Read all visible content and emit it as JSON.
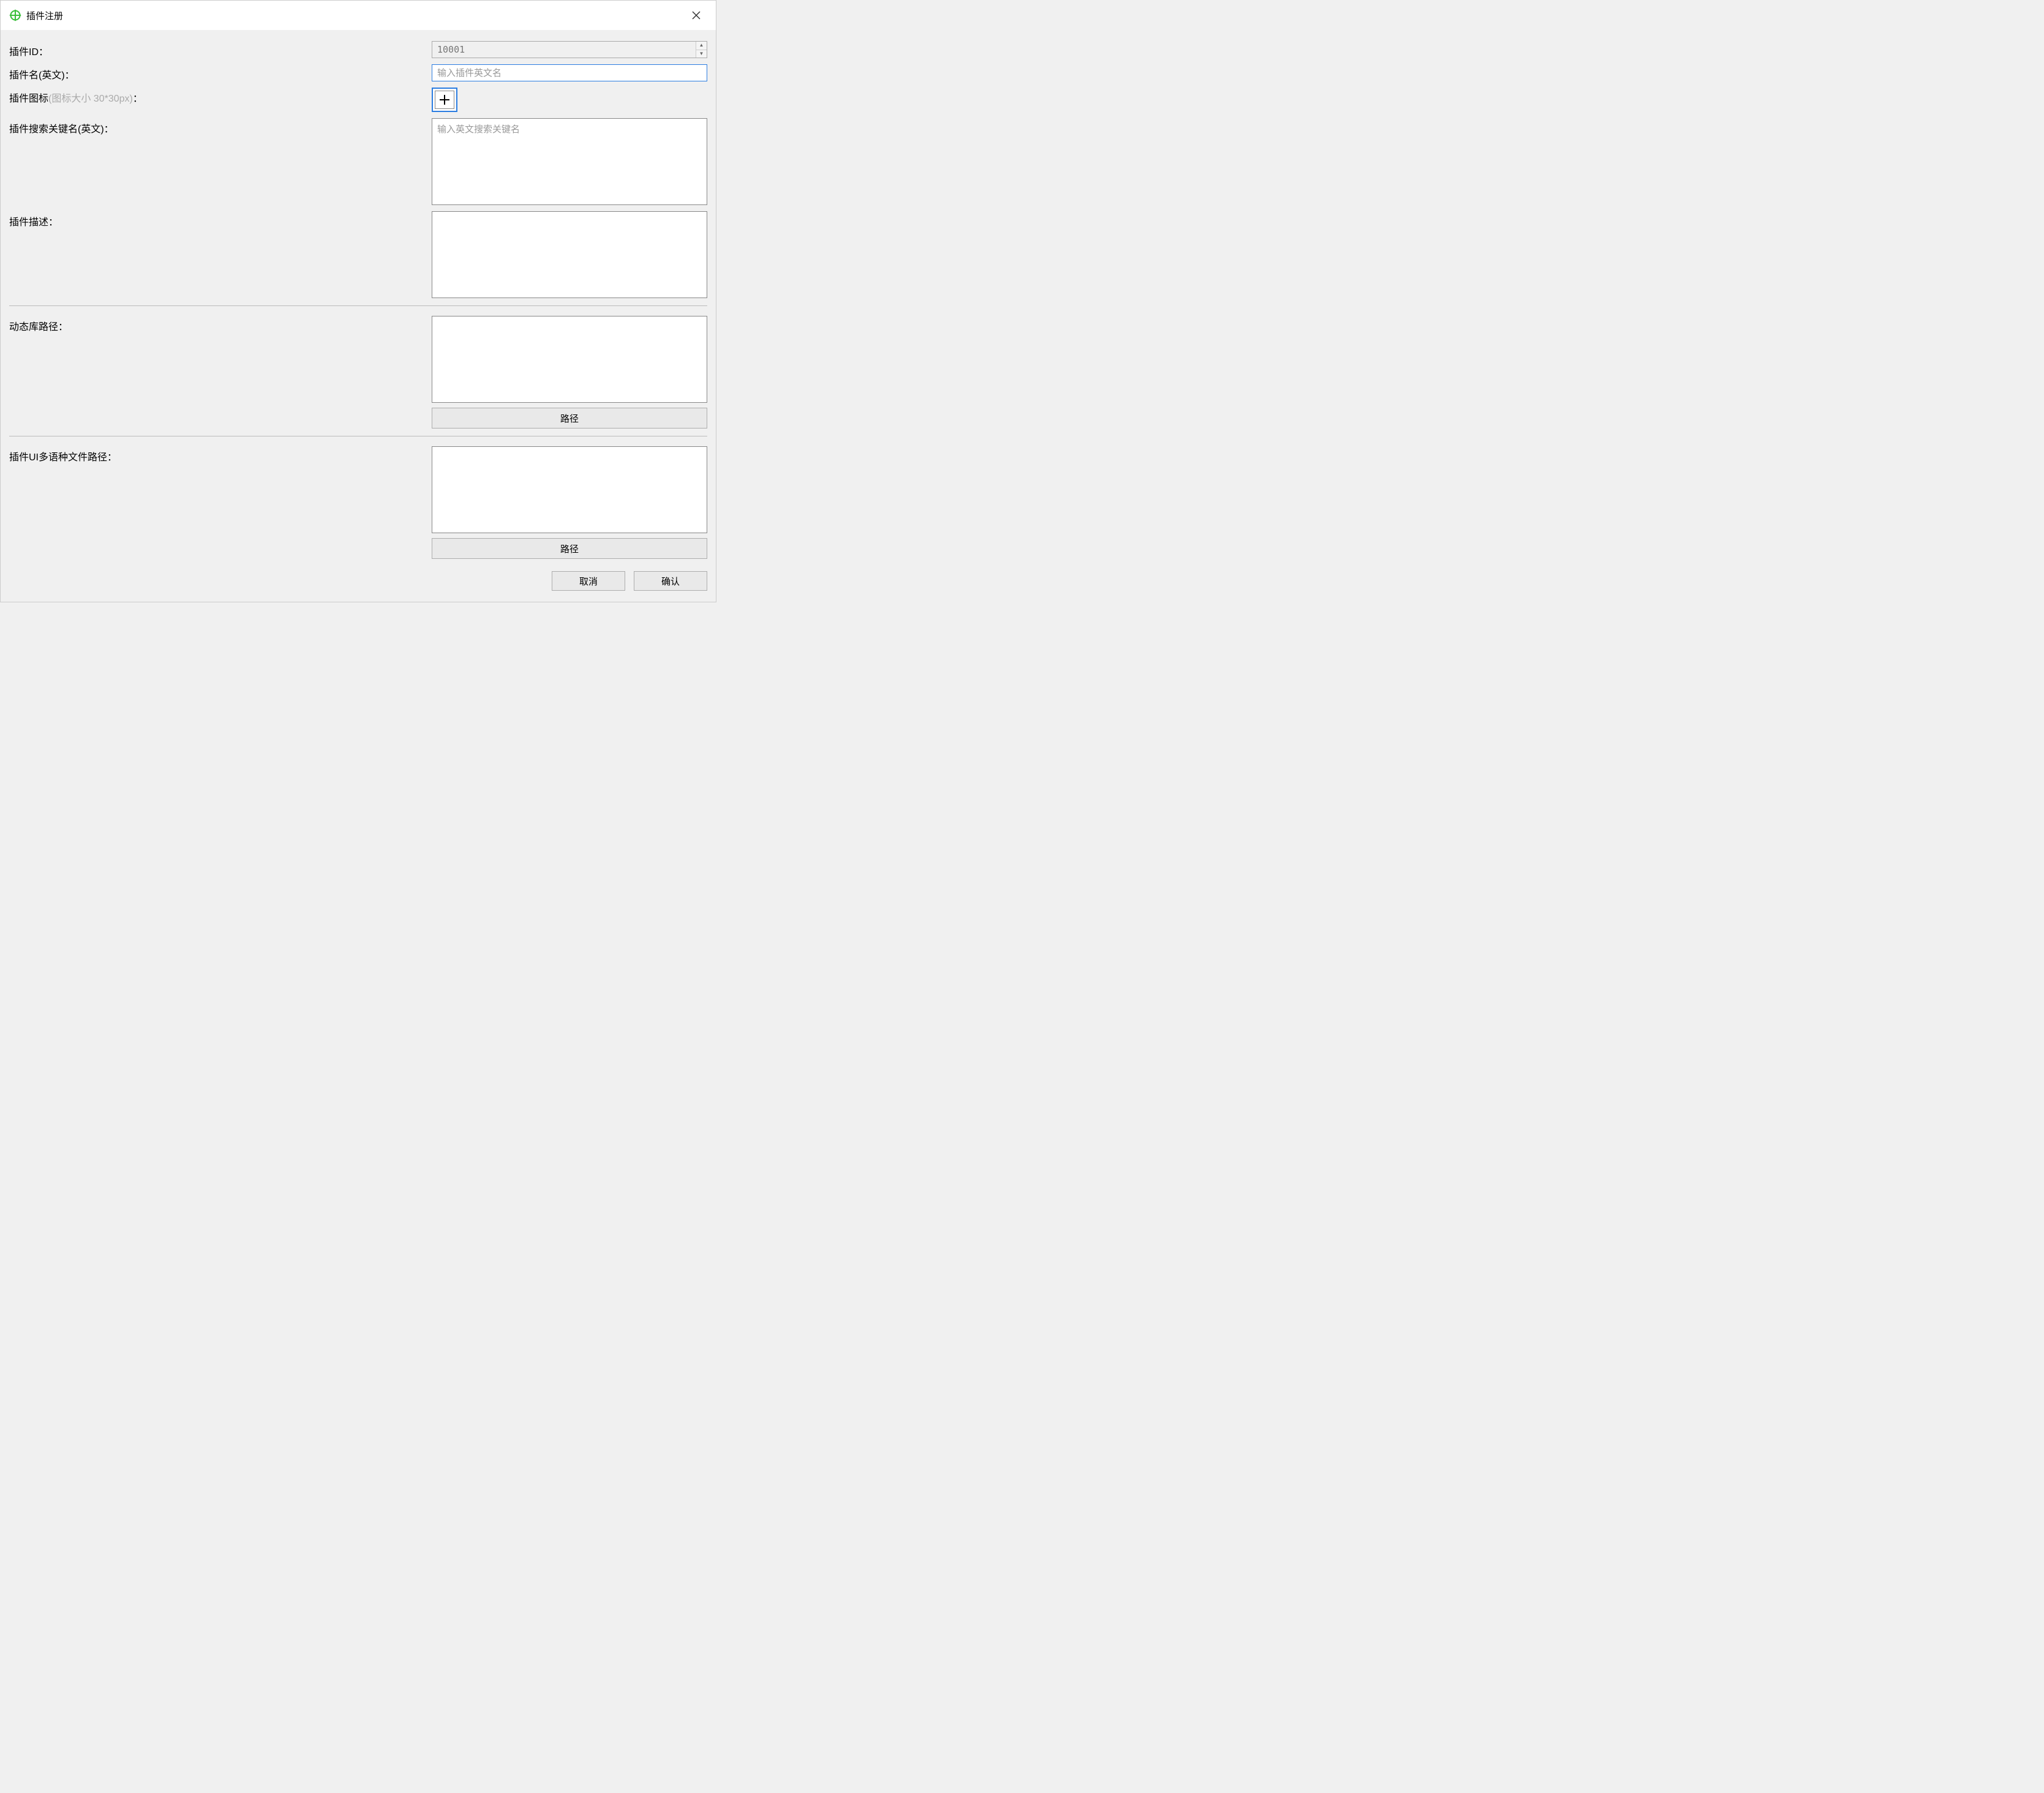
{
  "titlebar": {
    "title": "插件注册"
  },
  "form": {
    "plugin_id": {
      "label": "插件ID：",
      "value": "10001"
    },
    "plugin_name": {
      "label": "插件名(英文)：",
      "placeholder": "输入插件英文名",
      "value": ""
    },
    "plugin_icon": {
      "label_prefix": "插件图标",
      "label_hint": "(图标大小 30*30px)",
      "label_suffix": "："
    },
    "keywords": {
      "label": "插件搜索关键名(英文)：",
      "placeholder": "输入英文搜索关键名",
      "value": ""
    },
    "description": {
      "label": "插件描述：",
      "value": ""
    },
    "dll_path": {
      "label": "动态库路径：",
      "value": "",
      "button": "路径"
    },
    "ui_lang_path": {
      "label": "插件UI多语种文件路径：",
      "value": "",
      "button": "路径"
    }
  },
  "footer": {
    "cancel": "取消",
    "confirm": "确认"
  }
}
